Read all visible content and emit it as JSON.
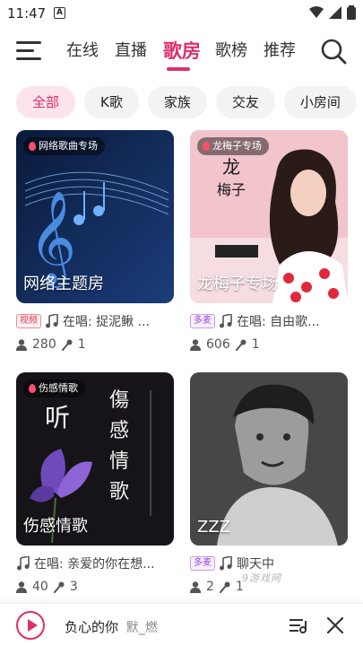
{
  "status": {
    "time": "11:47",
    "notif_letter": "A"
  },
  "nav": {
    "tabs": [
      "在线",
      "直播",
      "歌房",
      "歌榜",
      "推荐"
    ],
    "active_tab": "歌房"
  },
  "chips": [
    "全部",
    "K歌",
    "家族",
    "交友",
    "小房间"
  ],
  "active_chip": "全部",
  "rooms": [
    {
      "tag": "网络歌曲专场",
      "cover_title": "网络主题房",
      "badge": "视频",
      "now_playing": "在唱: 捉泥鳅 ...",
      "listeners": "280",
      "mics": "1"
    },
    {
      "tag": "龙梅子专场",
      "cover_title": "龙梅子专场",
      "badge": "多麦",
      "now_playing": "在唱: 自由歌...",
      "listeners": "606",
      "mics": "1"
    },
    {
      "tag": "伤感情歌",
      "cover_title": "伤感情歌",
      "badge": "",
      "now_playing": "在唱: 亲爱的你在想...",
      "listeners": "40",
      "mics": "3"
    },
    {
      "tag": "",
      "cover_title": "ZZZ",
      "badge": "多麦",
      "now_playing": "聊天中",
      "listeners": "2",
      "mics": "1"
    }
  ],
  "player": {
    "song": "负心的你",
    "artist": "默_燃"
  },
  "watermark": "9游戏网",
  "colors": {
    "accent": "#e02d6c",
    "chip_active_bg": "#fde3ec"
  }
}
